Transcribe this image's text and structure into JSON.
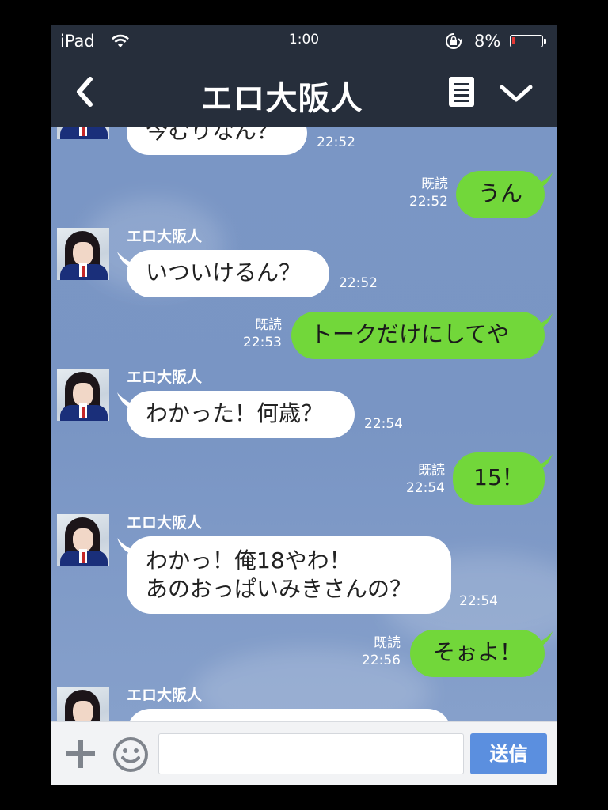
{
  "status_bar": {
    "device": "iPad",
    "time": "1:00",
    "battery_percent": "8%",
    "battery_level": 0.08,
    "battery_color": "#e53935"
  },
  "nav": {
    "title": "エロ大阪人",
    "back_icon": "chevron-left-icon",
    "notes_icon": "notes-icon",
    "menu_icon": "chevron-down-icon"
  },
  "messages": [
    {
      "direction": "in",
      "sender": "",
      "text": "今むりなん？",
      "time": "22:52"
    },
    {
      "direction": "out",
      "read": "既読",
      "text": "うん",
      "time": "22:52"
    },
    {
      "direction": "in",
      "sender": "エロ大阪人",
      "text": "いついけるん？",
      "time": "22:52"
    },
    {
      "direction": "out",
      "read": "既読",
      "text": "トークだけにしてや",
      "time": "22:53"
    },
    {
      "direction": "in",
      "sender": "エロ大阪人",
      "text": "わかった！何歳？",
      "time": "22:54"
    },
    {
      "direction": "out",
      "read": "既読",
      "text": "15！",
      "time": "22:54"
    },
    {
      "direction": "in",
      "sender": "エロ大阪人",
      "text": "わかっ！俺18やわ！",
      "text2": "あのおっぱいみきさんの？",
      "time": "22:54"
    },
    {
      "direction": "out",
      "read": "既読",
      "text": "そぉよ！",
      "time": "22:56"
    },
    {
      "direction": "in",
      "sender": "エロ大阪人",
      "text": "",
      "time": ""
    }
  ],
  "input": {
    "placeholder": "",
    "send_label": "送信",
    "send_color": "#5b8fdf"
  },
  "colors": {
    "header_bg": "#262e3b",
    "chat_bg": "#7b97c6",
    "outgoing_bubble": "#72d73a",
    "incoming_bubble": "#ffffff"
  }
}
